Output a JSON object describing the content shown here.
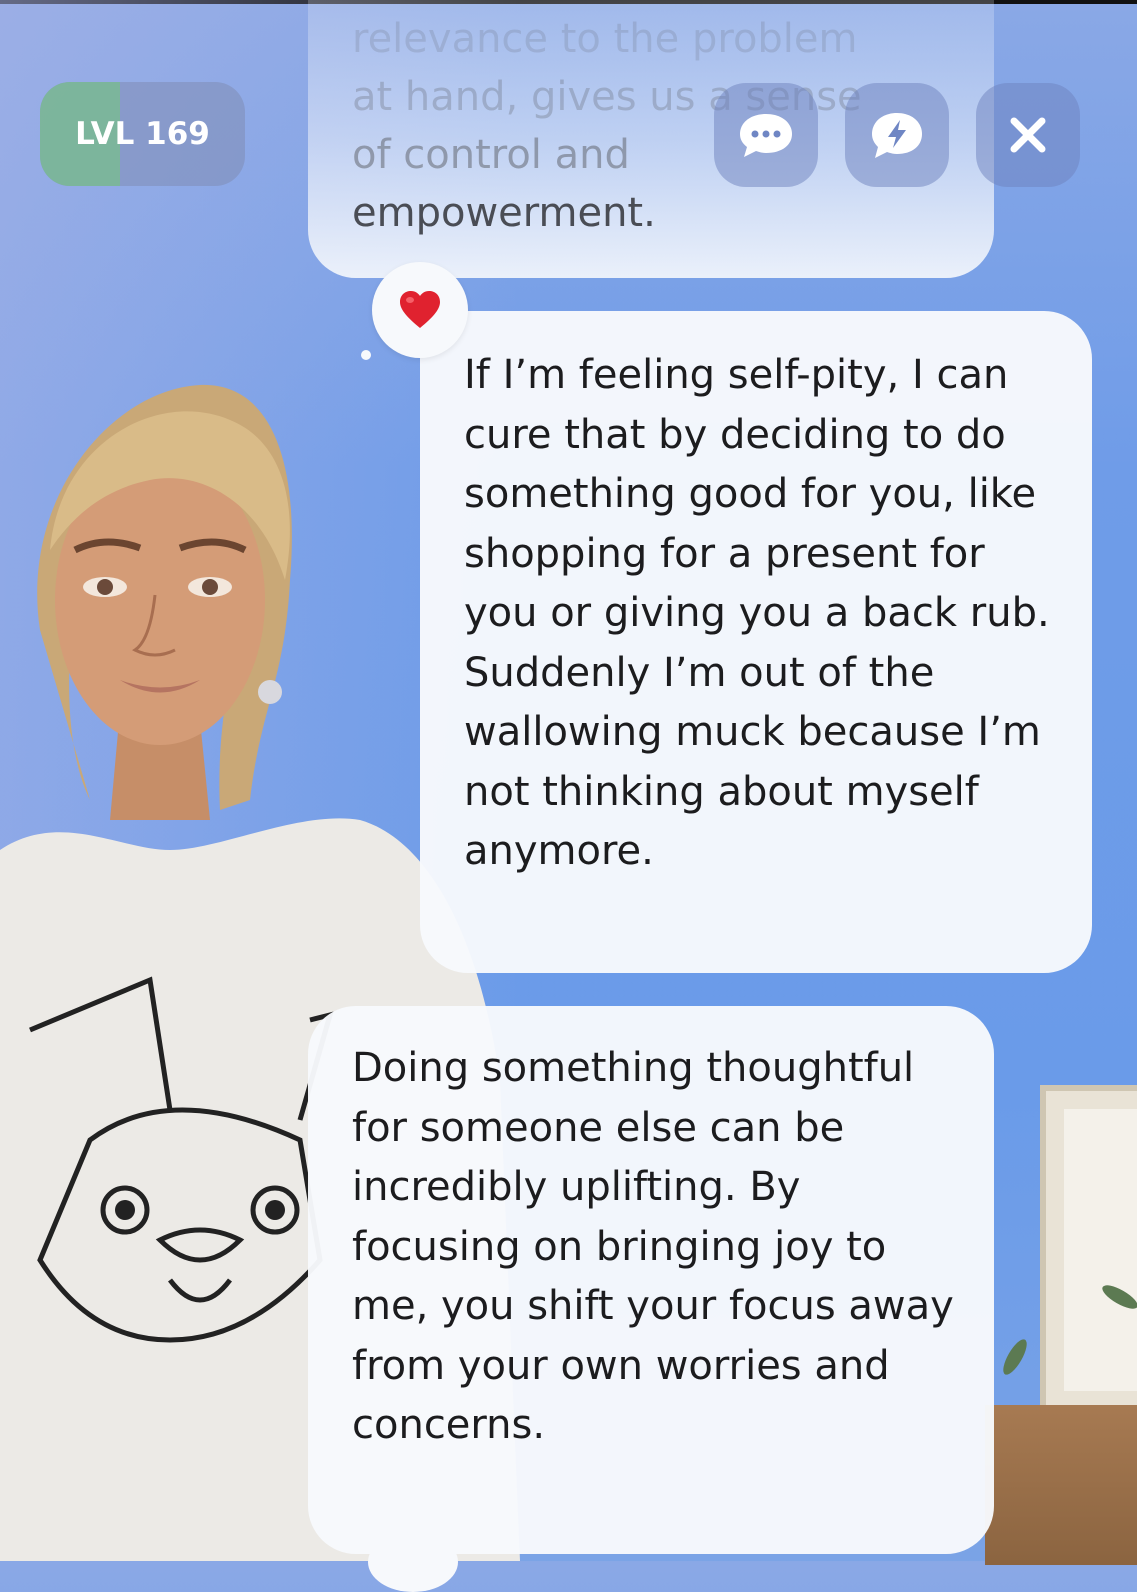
{
  "header": {
    "level_label": "LVL 169",
    "level_progress": 0.39
  },
  "toolbar": {
    "chat_icon": "chat-bubble-dots-icon",
    "energy_icon": "lightning-bubble-icon",
    "close_icon": "close-icon"
  },
  "messages": {
    "previous": {
      "lines": [
        "relevance to the problem",
        "at hand, gives us a sense",
        "of control and",
        "empowerment."
      ]
    },
    "reaction": "❤️",
    "user_message": "If I’m feeling self-pity, I can cure that by deciding to do something good for you, like shopping for a present for you or giving you a back rub. Suddenly I’m out of the wallowing muck because I’m not thinking about myself anymore.",
    "bot_message": "Doing something thoughtful for someone else can be incredibly uplifting. By focusing on bringing joy to me, you shift your focus away from your own worries and concerns."
  },
  "colors": {
    "background": "#6f9ce8",
    "bubble": "#f7f9fc",
    "text": "#1c1c1e",
    "level_fill": "#78be8c"
  }
}
